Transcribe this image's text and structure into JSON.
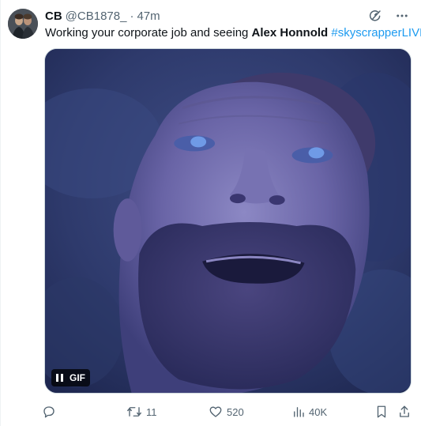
{
  "tweet": {
    "display_name": "CB",
    "handle": "@CB1878_",
    "separator": "·",
    "time": "47m",
    "text_prefix": "Working your corporate job and seeing ",
    "text_bold": "Alex Honnold",
    "text_space": " ",
    "hashtag": "#skyscrapperLIVE"
  },
  "media": {
    "badge": "GIF"
  },
  "actions": {
    "reply_count": "",
    "retweet_count": "11",
    "like_count": "520",
    "views_count": "40K"
  },
  "colors": {
    "accent": "#1d9bf0",
    "secondary_text": "#536471",
    "primary_text": "#0f1419"
  },
  "icons": {
    "grok": "grok-icon",
    "more": "more-icon",
    "reply": "reply-icon",
    "retweet": "retweet-icon",
    "like": "like-icon",
    "views": "views-icon",
    "bookmark": "bookmark-icon",
    "share": "share-icon"
  }
}
